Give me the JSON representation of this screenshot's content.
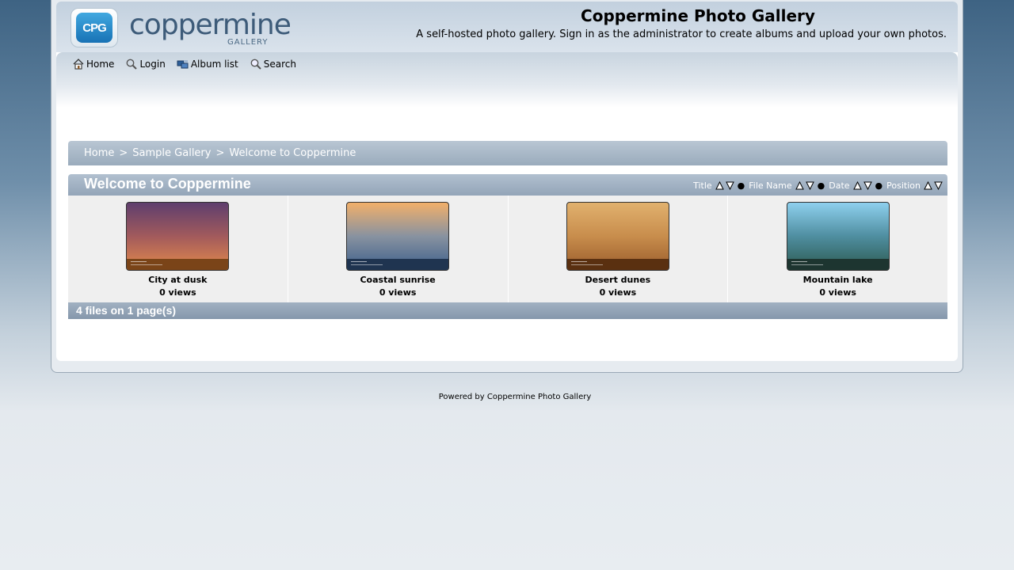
{
  "header": {
    "logo_badge": "CPG",
    "logo_text": "coppermine",
    "logo_sub": "GALLERY",
    "title": "Coppermine Photo Gallery",
    "description": "A self-hosted photo gallery. Sign in as the administrator to create albums and upload your own photos."
  },
  "nav": {
    "items": [
      {
        "label": "Home",
        "icon": "home-icon"
      },
      {
        "label": "Login",
        "icon": "login-icon"
      },
      {
        "label": "Album list",
        "icon": "album-list-icon"
      },
      {
        "label": "Search",
        "icon": "search-icon"
      }
    ]
  },
  "breadcrumb": {
    "items": [
      "Home",
      "Sample Gallery",
      "Welcome to Coppermine"
    ],
    "separator": ">"
  },
  "album": {
    "title": "Welcome to Coppermine",
    "sort": {
      "title": "Title",
      "file_name": "File Name",
      "date": "Date",
      "position": "Position"
    },
    "thumbnails": [
      {
        "title": "City at dusk",
        "views": "0 views",
        "colors": [
          "#5e3e6e",
          "#a25a5c",
          "#e38a4c"
        ],
        "strip": "#7a4418"
      },
      {
        "title": "Coastal sunrise",
        "views": "0 views",
        "colors": [
          "#f2b06a",
          "#8892a0",
          "#3d5f8b"
        ],
        "strip": "#1f3450"
      },
      {
        "title": "Desert dunes",
        "views": "0 views",
        "colors": [
          "#e1b16e",
          "#c88d4c",
          "#9a5d2c"
        ],
        "strip": "#5a3010"
      },
      {
        "title": "Mountain lake",
        "views": "0 views",
        "colors": [
          "#8ed0ee",
          "#4f8ea0",
          "#2c5a50"
        ],
        "strip": "#1d3530"
      }
    ],
    "footer": "4 files on 1 page(s)"
  },
  "powered": "Powered by Coppermine Photo Gallery"
}
